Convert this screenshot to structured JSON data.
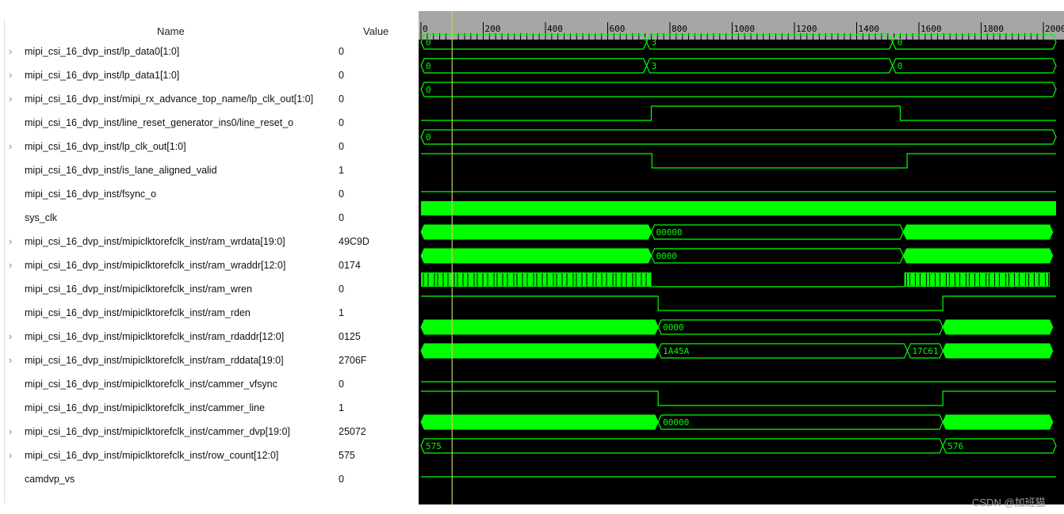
{
  "headers": {
    "name": "Name",
    "value": "Value"
  },
  "signals": [
    {
      "name": "mipi_csi_16_dvp_inst/lp_data0[1:0]",
      "value": "0",
      "bus": true,
      "wave": {
        "kind": "bus_line",
        "labels": [
          {
            "t": 0,
            "text": "0"
          },
          {
            "t": 725,
            "text": "3"
          },
          {
            "t": 1515,
            "text": "0"
          }
        ]
      }
    },
    {
      "name": "mipi_csi_16_dvp_inst/lp_data1[1:0]",
      "value": "0",
      "bus": true,
      "wave": {
        "kind": "bus_line",
        "labels": [
          {
            "t": 0,
            "text": "0"
          },
          {
            "t": 725,
            "text": "3"
          },
          {
            "t": 1515,
            "text": "0"
          }
        ]
      }
    },
    {
      "name": "mipi_csi_16_dvp_inst/mipi_rx_advance_top_name/lp_clk_out[1:0]",
      "value": "0",
      "bus": true,
      "wave": {
        "kind": "bus_line",
        "labels": [
          {
            "t": 0,
            "text": "0"
          }
        ]
      }
    },
    {
      "name": "mipi_csi_16_dvp_inst/line_reset_generator_ins0/line_reset_o",
      "value": "0",
      "bus": false,
      "wave": {
        "kind": "bit",
        "initial": 0,
        "edges": [
          740,
          1540
        ]
      }
    },
    {
      "name": "mipi_csi_16_dvp_inst/lp_clk_out[1:0]",
      "value": "0",
      "bus": true,
      "wave": {
        "kind": "bus_line",
        "labels": [
          {
            "t": 0,
            "text": "0"
          }
        ]
      }
    },
    {
      "name": "mipi_csi_16_dvp_inst/is_lane_aligned_valid",
      "value": "1",
      "bus": false,
      "wave": {
        "kind": "bit",
        "initial": 1,
        "edges": [
          742,
          1562
        ]
      }
    },
    {
      "name": "mipi_csi_16_dvp_inst/fsync_o",
      "value": "0",
      "bus": false,
      "wave": {
        "kind": "bit",
        "initial": 0,
        "edges": []
      }
    },
    {
      "name": "sys_clk",
      "value": "0",
      "bus": false,
      "wave": {
        "kind": "clock"
      }
    },
    {
      "name": "mipi_csi_16_dvp_inst/mipiclktorefclk_inst/ram_wrdata[19:0]",
      "value": "49C9D",
      "bus": true,
      "wave": {
        "kind": "bus_seg",
        "segments": [
          {
            "start": 0,
            "end": 740,
            "busy": true
          },
          {
            "start": 740,
            "end": 1550,
            "busy": false,
            "text": "00000"
          },
          {
            "start": 1550,
            "end": 2030,
            "busy": true
          }
        ]
      }
    },
    {
      "name": "mipi_csi_16_dvp_inst/mipiclktorefclk_inst/ram_wraddr[12:0]",
      "value": "0174",
      "bus": true,
      "wave": {
        "kind": "bus_seg",
        "segments": [
          {
            "start": 0,
            "end": 740,
            "busy": true
          },
          {
            "start": 740,
            "end": 1550,
            "busy": false,
            "text": "0000"
          },
          {
            "start": 1550,
            "end": 2030,
            "busy": true
          }
        ]
      }
    },
    {
      "name": "mipi_csi_16_dvp_inst/mipiclktorefclk_inst/ram_wren",
      "value": "0",
      "bus": false,
      "wave": {
        "kind": "pulses",
        "ranges": [
          [
            0,
            740
          ],
          [
            1553,
            2020
          ]
        ]
      }
    },
    {
      "name": "mipi_csi_16_dvp_inst/mipiclktorefclk_inst/ram_rden",
      "value": "1",
      "bus": false,
      "wave": {
        "kind": "bit",
        "initial": 1,
        "edges": [
          762,
          1677
        ]
      }
    },
    {
      "name": "mipi_csi_16_dvp_inst/mipiclktorefclk_inst/ram_rdaddr[12:0]",
      "value": "0125",
      "bus": true,
      "wave": {
        "kind": "bus_seg",
        "segments": [
          {
            "start": 0,
            "end": 762,
            "busy": true
          },
          {
            "start": 762,
            "end": 1677,
            "busy": false,
            "text": "0000"
          },
          {
            "start": 1677,
            "end": 2030,
            "busy": true
          }
        ]
      }
    },
    {
      "name": "mipi_csi_16_dvp_inst/mipiclktorefclk_inst/ram_rddata[19:0]",
      "value": "2706F",
      "bus": true,
      "wave": {
        "kind": "bus_seg",
        "segments": [
          {
            "start": 0,
            "end": 762,
            "busy": true
          },
          {
            "start": 762,
            "end": 1563,
            "busy": false,
            "text": "1A45A"
          },
          {
            "start": 1563,
            "end": 1677,
            "busy": false,
            "text": "17C61"
          },
          {
            "start": 1677,
            "end": 2030,
            "busy": true
          }
        ]
      }
    },
    {
      "name": "mipi_csi_16_dvp_inst/mipiclktorefclk_inst/cammer_vfsync",
      "value": "0",
      "bus": false,
      "wave": {
        "kind": "bit",
        "initial": 0,
        "edges": []
      }
    },
    {
      "name": "mipi_csi_16_dvp_inst/mipiclktorefclk_inst/cammer_line",
      "value": "1",
      "bus": false,
      "wave": {
        "kind": "bit",
        "initial": 1,
        "edges": [
          762,
          1677
        ]
      }
    },
    {
      "name": "mipi_csi_16_dvp_inst/mipiclktorefclk_inst/cammer_dvp[19:0]",
      "value": "25072",
      "bus": true,
      "wave": {
        "kind": "bus_seg",
        "segments": [
          {
            "start": 0,
            "end": 762,
            "busy": true
          },
          {
            "start": 762,
            "end": 1677,
            "busy": false,
            "text": "00000"
          },
          {
            "start": 1677,
            "end": 2030,
            "busy": true
          }
        ]
      }
    },
    {
      "name": "mipi_csi_16_dvp_inst/mipiclktorefclk_inst/row_count[12:0]",
      "value": "575",
      "bus": true,
      "wave": {
        "kind": "bus_line",
        "labels": [
          {
            "t": 0,
            "text": "575"
          },
          {
            "t": 1677,
            "text": "576"
          }
        ]
      }
    },
    {
      "name": "camdvp_vs",
      "value": "0",
      "bus": false,
      "wave": {
        "kind": "bit",
        "initial": 0,
        "edges": []
      }
    }
  ],
  "ruler": {
    "labels": [
      "0",
      "200",
      "400",
      "600",
      "800",
      "1000",
      "1200",
      "1400",
      "1600",
      "1800",
      "2000"
    ],
    "range": [
      0,
      2000
    ]
  },
  "cursor_time": 100,
  "colors": {
    "wave": "#00ff00",
    "background": "#000000",
    "cursor": "#c8c864",
    "ruler_bg": "#a6a6a6"
  },
  "watermark": "CSDN @加班猫"
}
